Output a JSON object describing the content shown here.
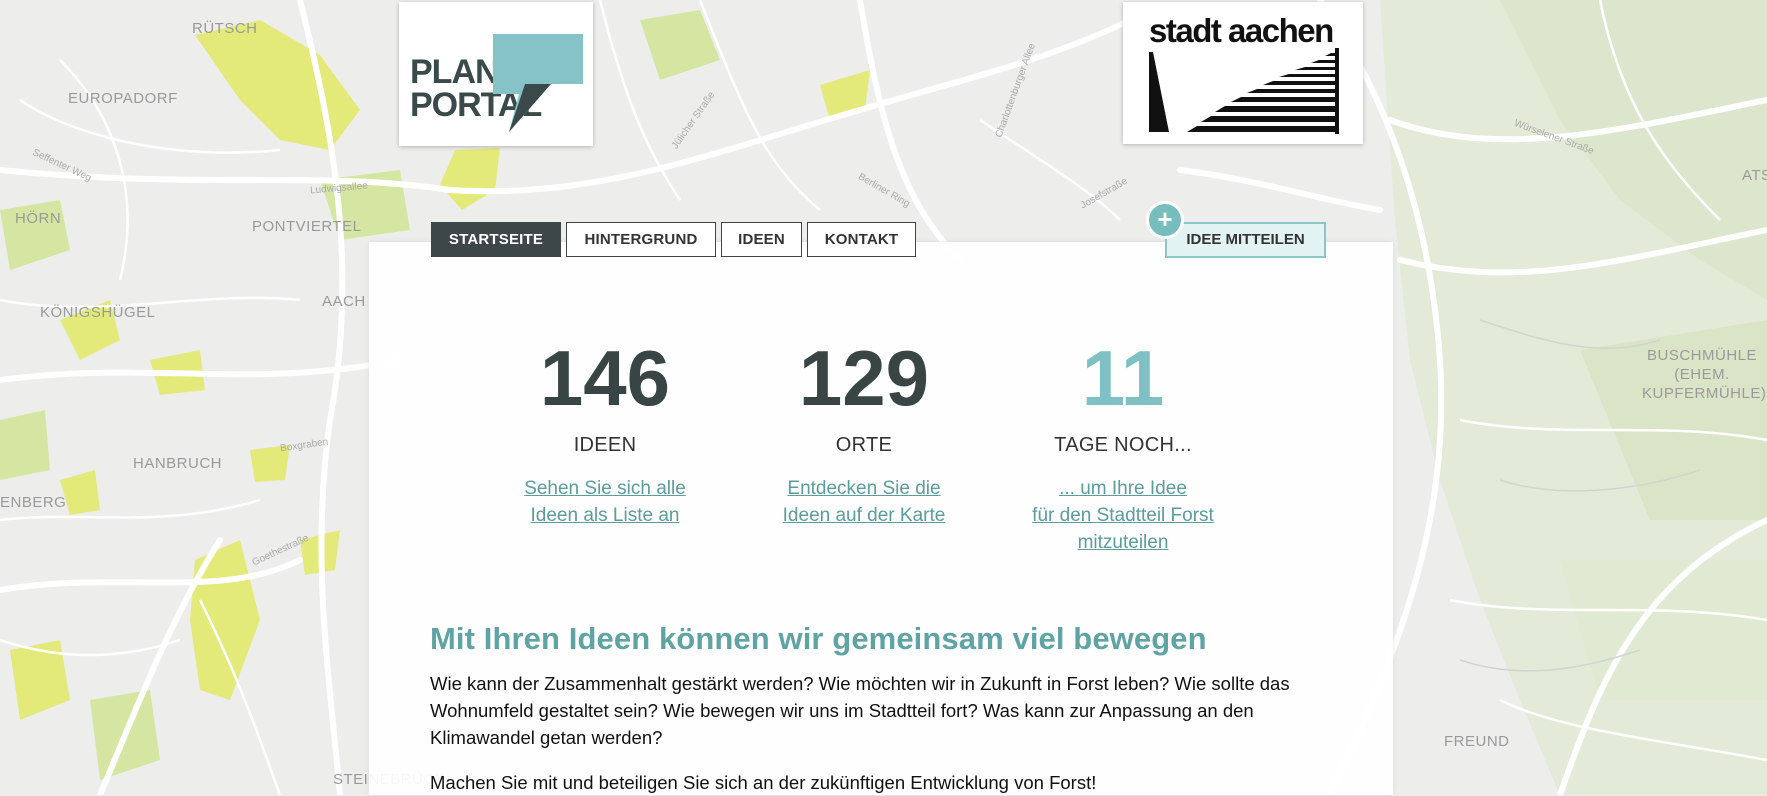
{
  "map_labels": [
    "RÜTSCH",
    "EUROPADORF",
    "HÖRN",
    "PONTVIERTEL",
    "KÖNIGSHÜGEL",
    "HANBRUCH",
    "ENBERG",
    "AACH",
    "FREUND",
    "STEINEBRÜCK",
    "ATS",
    "BUSCHMÜHLE (EHEM. KUPFERMÜHLE)",
    "Würselener Straße",
    "Ludwigsallee",
    "Seffenter Weg",
    "Boxgraben",
    "Berliner Ring",
    "Josefstraße",
    "Charlottenburger Allee",
    "Jülicher Straße",
    "Goethestraße"
  ],
  "logos": {
    "planportal": {
      "line1": "PLAN",
      "line2": "PORTAL",
      "accent": "#86c3c6"
    },
    "aachen": {
      "text": "stadt aachen"
    }
  },
  "nav": {
    "items": [
      {
        "label": "STARTSEITE",
        "active": true
      },
      {
        "label": "HINTERGRUND",
        "active": false
      },
      {
        "label": "IDEEN",
        "active": false
      },
      {
        "label": "KONTAKT",
        "active": false
      }
    ],
    "cta_label": "IDEE MITTEILEN",
    "cta_icon": "plus-icon"
  },
  "stats": [
    {
      "number": "146",
      "label": "IDEEN",
      "link_line1": "Sehen Sie sich alle",
      "link_line2": "Ideen als Liste an",
      "link_line3": ""
    },
    {
      "number": "129",
      "label": "ORTE",
      "link_line1": "Entdecken Sie die",
      "link_line2": "Ideen auf der Karte",
      "link_line3": ""
    },
    {
      "number": "11",
      "label": "TAGE NOCH...",
      "link_line1": "... um Ihre Idee",
      "link_line2": "für den Stadtteil Forst",
      "link_line3": "mitzuteilen"
    }
  ],
  "content": {
    "headline": "Mit Ihren Ideen können wir gemeinsam viel bewegen",
    "paragraph1": "Wie kann der Zusammenhalt gestärkt werden? Wie möchten wir in Zukunft in Forst leben? Wie sollte das Wohnumfeld gestaltet sein? Wie bewegen wir uns im Stadtteil fort? Was kann zur Anpassung an den Klimawandel getan werden?",
    "paragraph2": "Machen Sie mit und beteiligen Sie sich an der zukünftigen Entwicklung von Forst!"
  },
  "colors": {
    "dark": "#3d4747",
    "accent": "#7ec0c3",
    "headline": "#5fa3a3",
    "link": "#5b9c9c",
    "map_green": "#d4e7a0",
    "map_yellow": "#e4ec7c"
  }
}
